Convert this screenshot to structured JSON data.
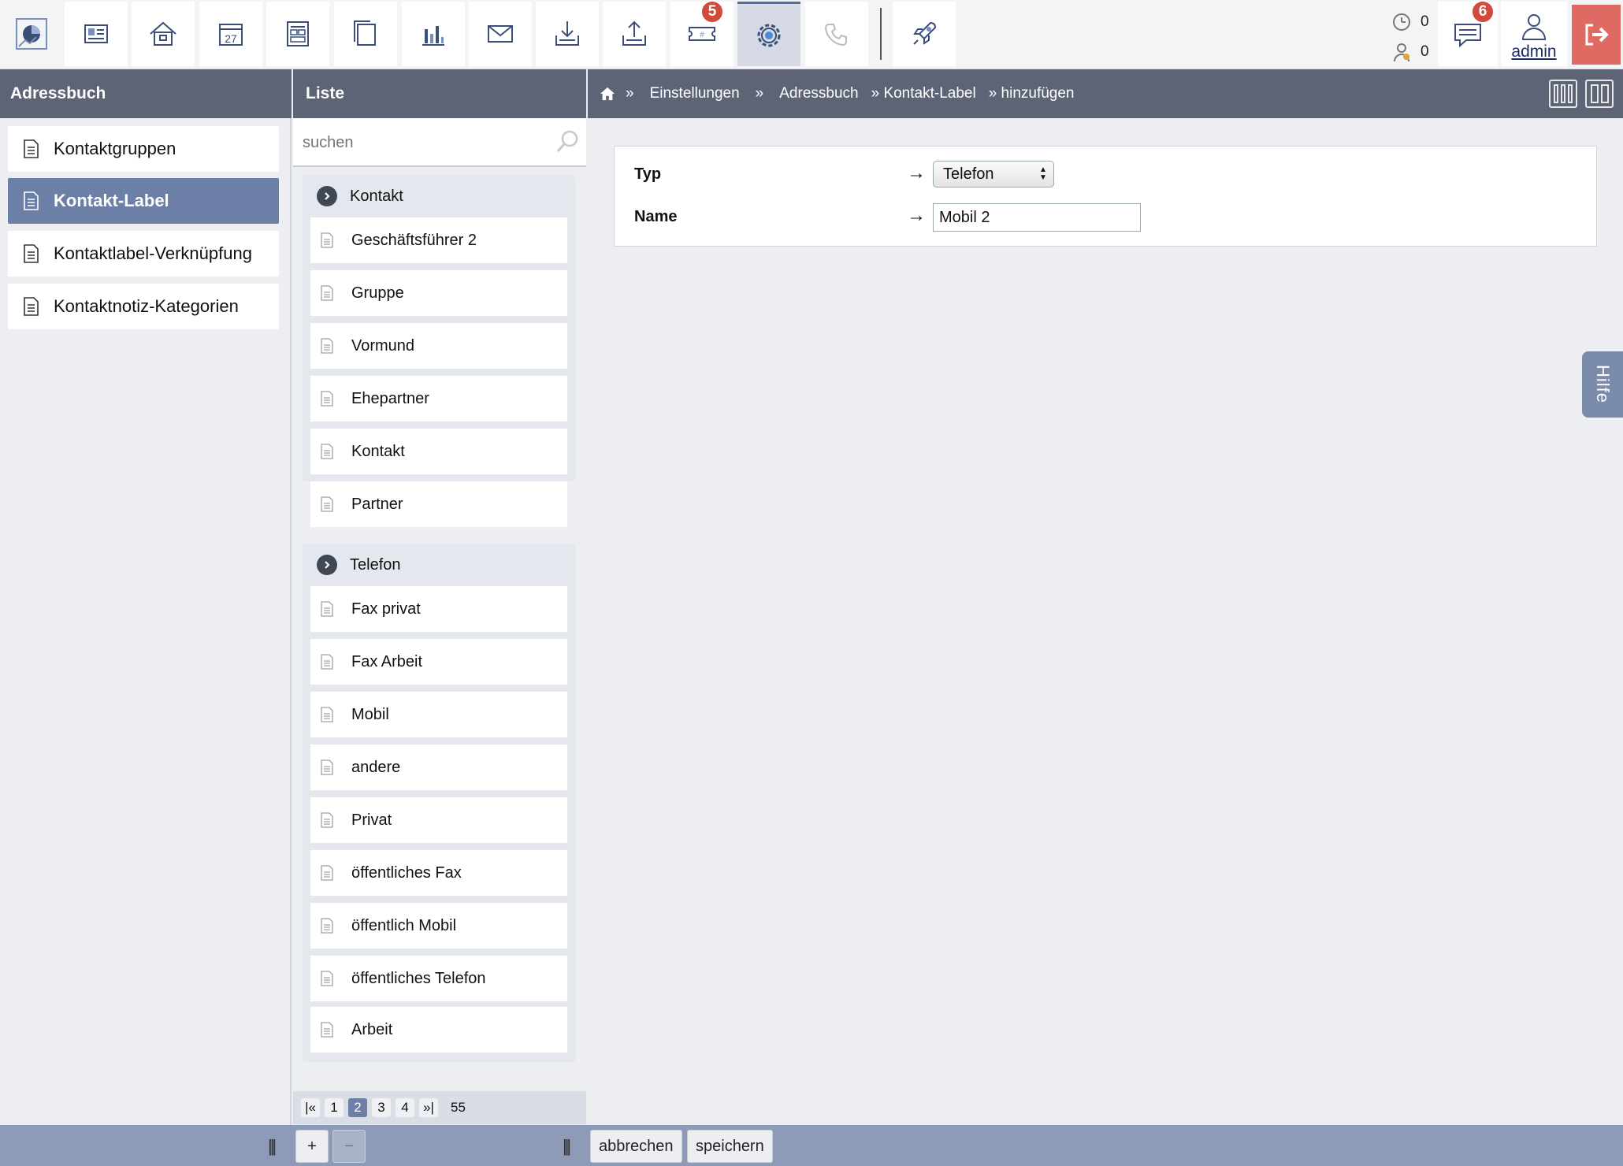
{
  "toolbar": {
    "buttons": [
      {
        "name": "dashboard-icon",
        "active": false,
        "badge": ""
      },
      {
        "name": "address-book-icon",
        "active": false,
        "badge": ""
      },
      {
        "name": "house-icon",
        "active": false,
        "badge": ""
      },
      {
        "name": "calendar-icon",
        "active": false,
        "badge": "",
        "text": "27"
      },
      {
        "name": "layout-icon",
        "active": false,
        "badge": ""
      },
      {
        "name": "documents-icon",
        "active": false,
        "badge": ""
      },
      {
        "name": "chart-icon",
        "active": false,
        "badge": ""
      },
      {
        "name": "mail-icon",
        "active": false,
        "badge": ""
      },
      {
        "name": "download-icon",
        "active": false,
        "badge": ""
      },
      {
        "name": "upload-icon",
        "active": false,
        "badge": ""
      },
      {
        "name": "ticket-icon",
        "active": false,
        "badge": "5"
      },
      {
        "name": "settings-gear-icon",
        "active": true,
        "badge": ""
      },
      {
        "name": "phone-icon",
        "active": false,
        "badge": ""
      },
      {
        "name": "rocket-icon",
        "active": false,
        "badge": ""
      }
    ],
    "counter_top": "0",
    "counter_bottom": "0",
    "messages_badge": "6",
    "user_name": "admin",
    "colors": {
      "accent": "#6c7fa6",
      "header": "#5d6475",
      "badge": "#d04b3c",
      "logout": "#df6a63"
    }
  },
  "headers": {
    "adressbuch": "Adressbuch",
    "liste": "Liste"
  },
  "breadcrumb": {
    "sep1": "»",
    "einstellungen": "Einstellungen",
    "sep2": "»",
    "adressbuch": "Adressbuch",
    "kontakt_label": "» Kontakt-Label",
    "hinzufuegen": "» hinzufügen"
  },
  "sidebar": {
    "items": [
      {
        "label": "Kontaktgruppen",
        "active": false
      },
      {
        "label": "Kontakt-Label",
        "active": true
      },
      {
        "label": "Kontaktlabel-Verknüpfung",
        "active": false
      },
      {
        "label": "Kontaktnotiz-Kategorien",
        "active": false
      }
    ]
  },
  "list": {
    "search_placeholder": "suchen",
    "groups": [
      {
        "title": "Kontakt",
        "items": [
          "Geschäftsführer 2",
          "Gruppe",
          "Vormund",
          "Ehepartner",
          "Kontakt",
          "Partner"
        ]
      },
      {
        "title": "Telefon",
        "items": [
          "Fax privat",
          "Fax Arbeit",
          "Mobil",
          "andere",
          "Privat",
          "öffentliches Fax",
          "öffentlich Mobil",
          "öffentliches Telefon",
          "Arbeit"
        ]
      }
    ],
    "pager": {
      "first": "|«",
      "pages": [
        "1",
        "2",
        "3",
        "4"
      ],
      "current": "2",
      "last": "»|",
      "total": "55"
    }
  },
  "form": {
    "typ_label": "Typ",
    "typ_value": "Telefon",
    "name_label": "Name",
    "name_value": "Mobil 2",
    "arrow": "→"
  },
  "help_tab": "Hilfe",
  "bottom": {
    "add": "+",
    "remove": "−",
    "cancel": "abbrechen",
    "save": "speichern",
    "grip": "|||"
  }
}
